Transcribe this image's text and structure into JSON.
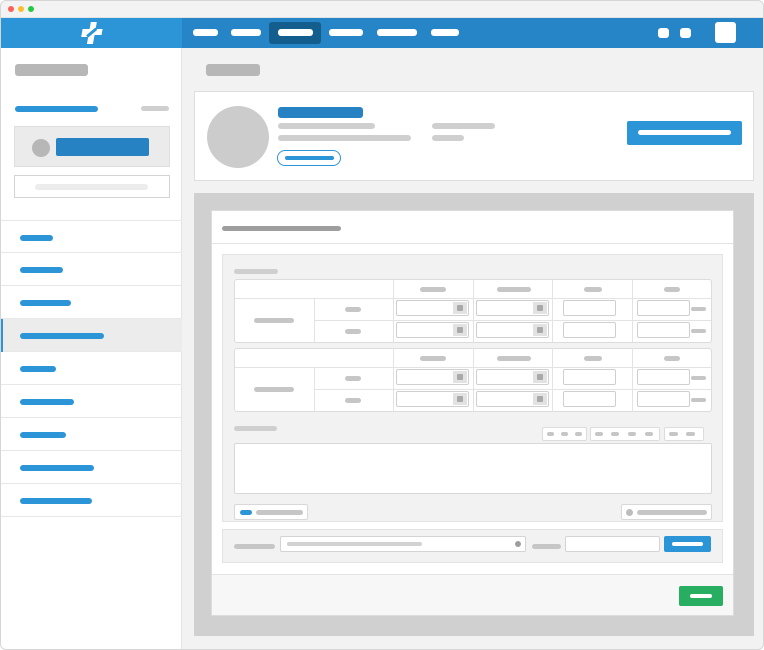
{
  "window": {
    "traffic_lights": [
      "#ff5f57",
      "#ffbd2e",
      "#28c840"
    ]
  },
  "topbar": {
    "logo_icon": "medical-cross-icon",
    "nav_items": [
      "",
      "",
      "",
      "",
      "",
      ""
    ],
    "active_nav_index": 2,
    "right_icons": [
      "notification-icon",
      "message-icon",
      "user-avatar-icon"
    ]
  },
  "sidebar": {
    "items": [
      "",
      "",
      "",
      "",
      "",
      "",
      "",
      "",
      ""
    ],
    "active_index": 3
  },
  "form": {
    "submit_color": "#27ae60",
    "primary_color": "#2b95d8"
  }
}
